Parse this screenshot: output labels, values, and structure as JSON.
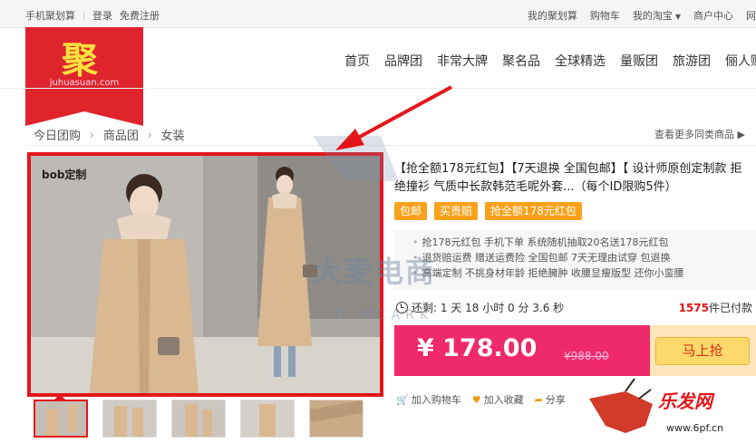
{
  "topbar": {
    "mobile": "手机聚划算",
    "login": "登录",
    "register": "免费注册",
    "right_links": [
      "我的聚划算",
      "购物车",
      "我的淘宝",
      "商户中心",
      "网"
    ]
  },
  "logo": {
    "char": "聚",
    "site": "juhuasuan.com"
  },
  "nav": [
    "首页",
    "品牌团",
    "非常大牌",
    "聚名品",
    "全球精选",
    "量贩团",
    "旅游团",
    "俪人购"
  ],
  "breadcrumb": [
    "今日团购",
    "商品团",
    "女装"
  ],
  "more_link": "查看更多同类商品",
  "image_label": "bob定制",
  "product": {
    "title": "【抢全额178元红包】【7天退换 全国包邮】【 设计师原创定制款 拒绝撞衫 气质中长款韩范毛呢外套...（每个ID限购5件）",
    "tags": [
      "包邮",
      "买贵赔",
      "抢全额178元红包"
    ],
    "promos": [
      "抢178元红包 手机下单 系统随机抽取20名送178元红包",
      "退货赔运费 赠送运费险 全国包邮 7天无理由试穿 包退换",
      "高端定制 不挑身材年龄 拒绝臃肿 收腰显瘦版型 还你小蛮腰"
    ],
    "countdown": "还剩: 1 天 18 小时 0 分 3.6 秒",
    "paid_count": "1575",
    "paid_suffix": "件已付款",
    "price": "¥ 178.00",
    "old_price": "¥988.00",
    "buy_label": "马上抢",
    "actions": [
      "加入购物车",
      "加入收藏",
      "分享"
    ]
  },
  "watermarks": {
    "main": "大麦电商",
    "sub": "D-MCARK",
    "badge": "乐发网",
    "url": "www.6pf.cn"
  },
  "colors": {
    "brand_red": "#e0242c",
    "price_bar": "#ee2a6b",
    "tag_orange": "#f8a21b",
    "buy_button": "#fcd96a",
    "annotation": "#e3161b"
  }
}
